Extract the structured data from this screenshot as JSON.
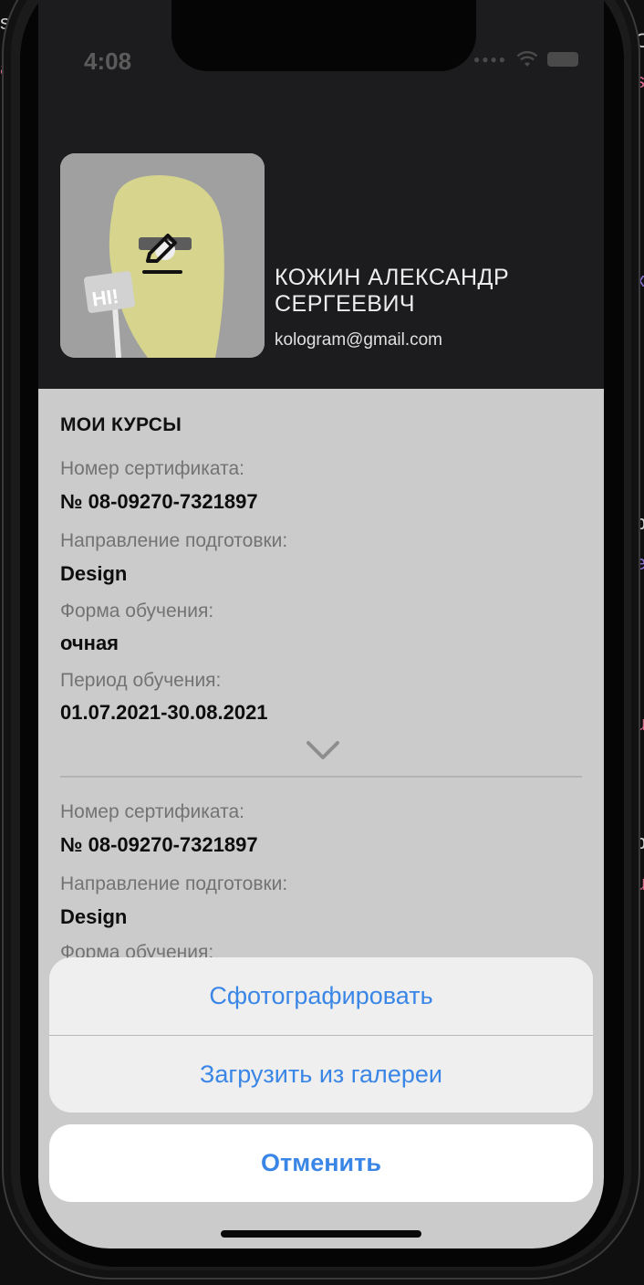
{
  "background": {
    "left_fragments": [
      "sof",
      "a"
    ],
    "right_fragments": [
      "C",
      "s",
      "x",
      "b",
      "e",
      "u",
      "b",
      "u"
    ]
  },
  "status_bar": {
    "time": "4:08"
  },
  "profile": {
    "name": "КОЖИН АЛЕКСАНДР СЕРГЕЕВИЧ",
    "email": "kologram@gmail.com",
    "avatar_sign_text": "HI!"
  },
  "courses": {
    "title": "МОИ КУРСЫ",
    "items": [
      {
        "cert_label": "Номер сертификата:",
        "cert_value": "№ 08-09270-7321897",
        "direction_label": "Направление подготовки:",
        "direction_value": "Design",
        "form_label": "Форма обучения:",
        "form_value": "очная",
        "period_label": "Период обучения:",
        "period_value": "01.07.2021-30.08.2021"
      },
      {
        "cert_label": "Номер сертификата:",
        "cert_value": "№ 08-09270-7321897",
        "direction_label": "Направление подготовки:",
        "direction_value": "Design",
        "form_label": "Форма обучения:"
      }
    ]
  },
  "action_sheet": {
    "take_photo": "Сфотографировать",
    "from_gallery": "Загрузить из галереи",
    "cancel": "Отменить"
  },
  "colors": {
    "accent": "#3a86e6",
    "header_bg": "#1c1c1e",
    "content_bg": "#cbcbcb"
  }
}
